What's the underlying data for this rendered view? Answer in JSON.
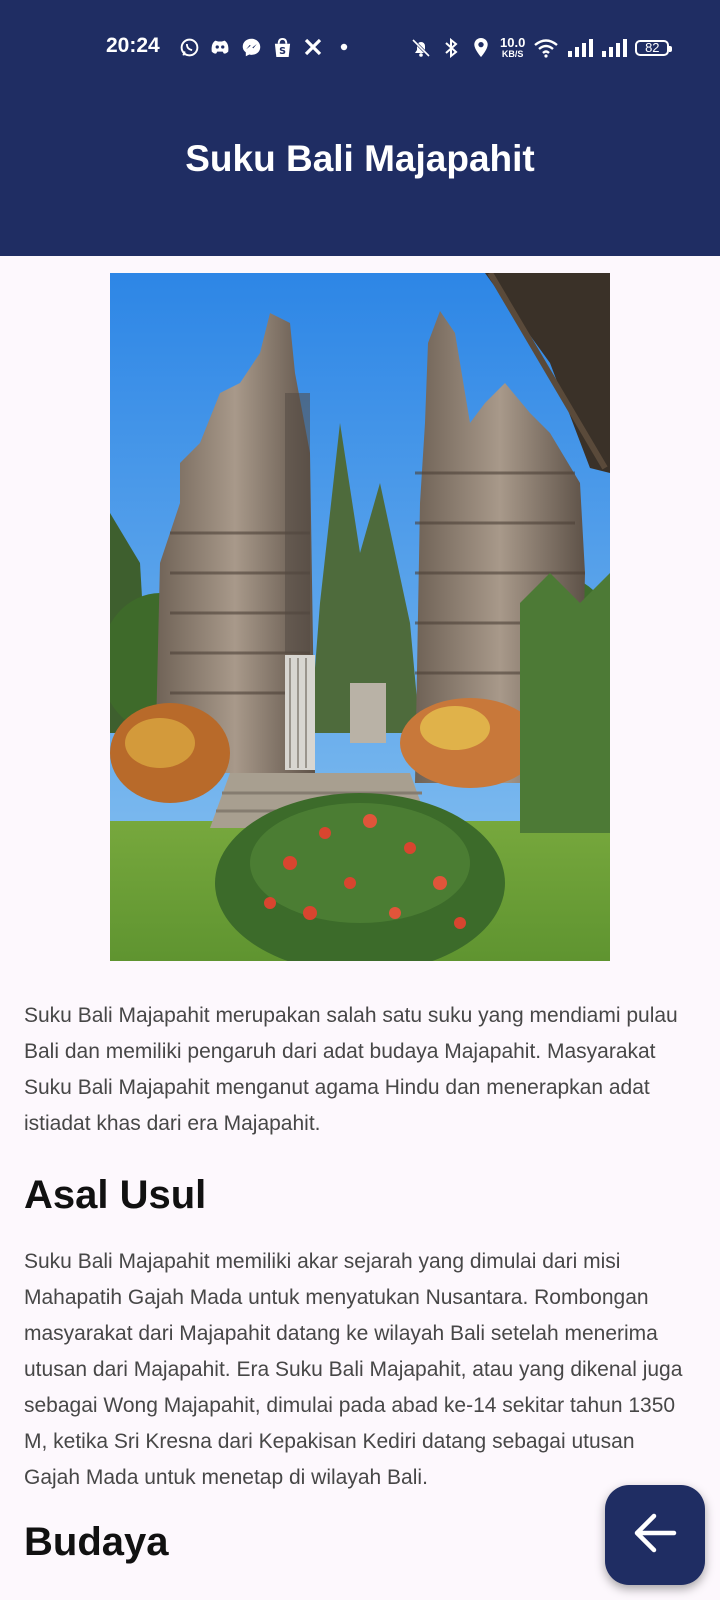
{
  "status_bar": {
    "time": "20:24",
    "net_speed_value": "10.0",
    "net_speed_unit": "KB/S",
    "battery": "82",
    "left_icons": [
      "whatsapp-icon",
      "discord-icon",
      "messenger-icon",
      "shopee-icon",
      "x-icon",
      "dot-icon"
    ],
    "right_icons": [
      "mute-icon",
      "bluetooth-icon",
      "location-icon",
      "wifi-icon",
      "signal-icon",
      "signal-icon"
    ]
  },
  "app_bar": {
    "title": "Suku Bali Majapahit",
    "background": "#1f2d63"
  },
  "article": {
    "intro": "Suku Bali Majapahit merupakan salah satu suku yang mendiami pulau Bali dan memiliki pengaruh dari adat budaya Majapahit. Masyarakat Suku Bali Majapahit menganut agama Hindu dan menerapkan adat istiadat khas dari era Majapahit.",
    "section1_title": "Asal Usul",
    "section1_text": "Suku Bali Majapahit memiliki akar sejarah yang dimulai dari misi Mahapatih Gajah Mada untuk menyatukan Nusantara. Rombongan masyarakat dari Majapahit datang ke wilayah Bali setelah menerima utusan dari Majapahit. Era Suku Bali Majapahit, atau yang dikenal juga sebagai Wong Majapahit, dimulai pada abad ke-14 sekitar tahun 1350 M, ketika Sri Kresna dari Kepakisan Kediri datang sebagai utusan Gajah Mada untuk menetap di wilayah Bali.",
    "section2_title": "Budaya"
  },
  "fab": {
    "icon": "arrow-left-icon"
  }
}
